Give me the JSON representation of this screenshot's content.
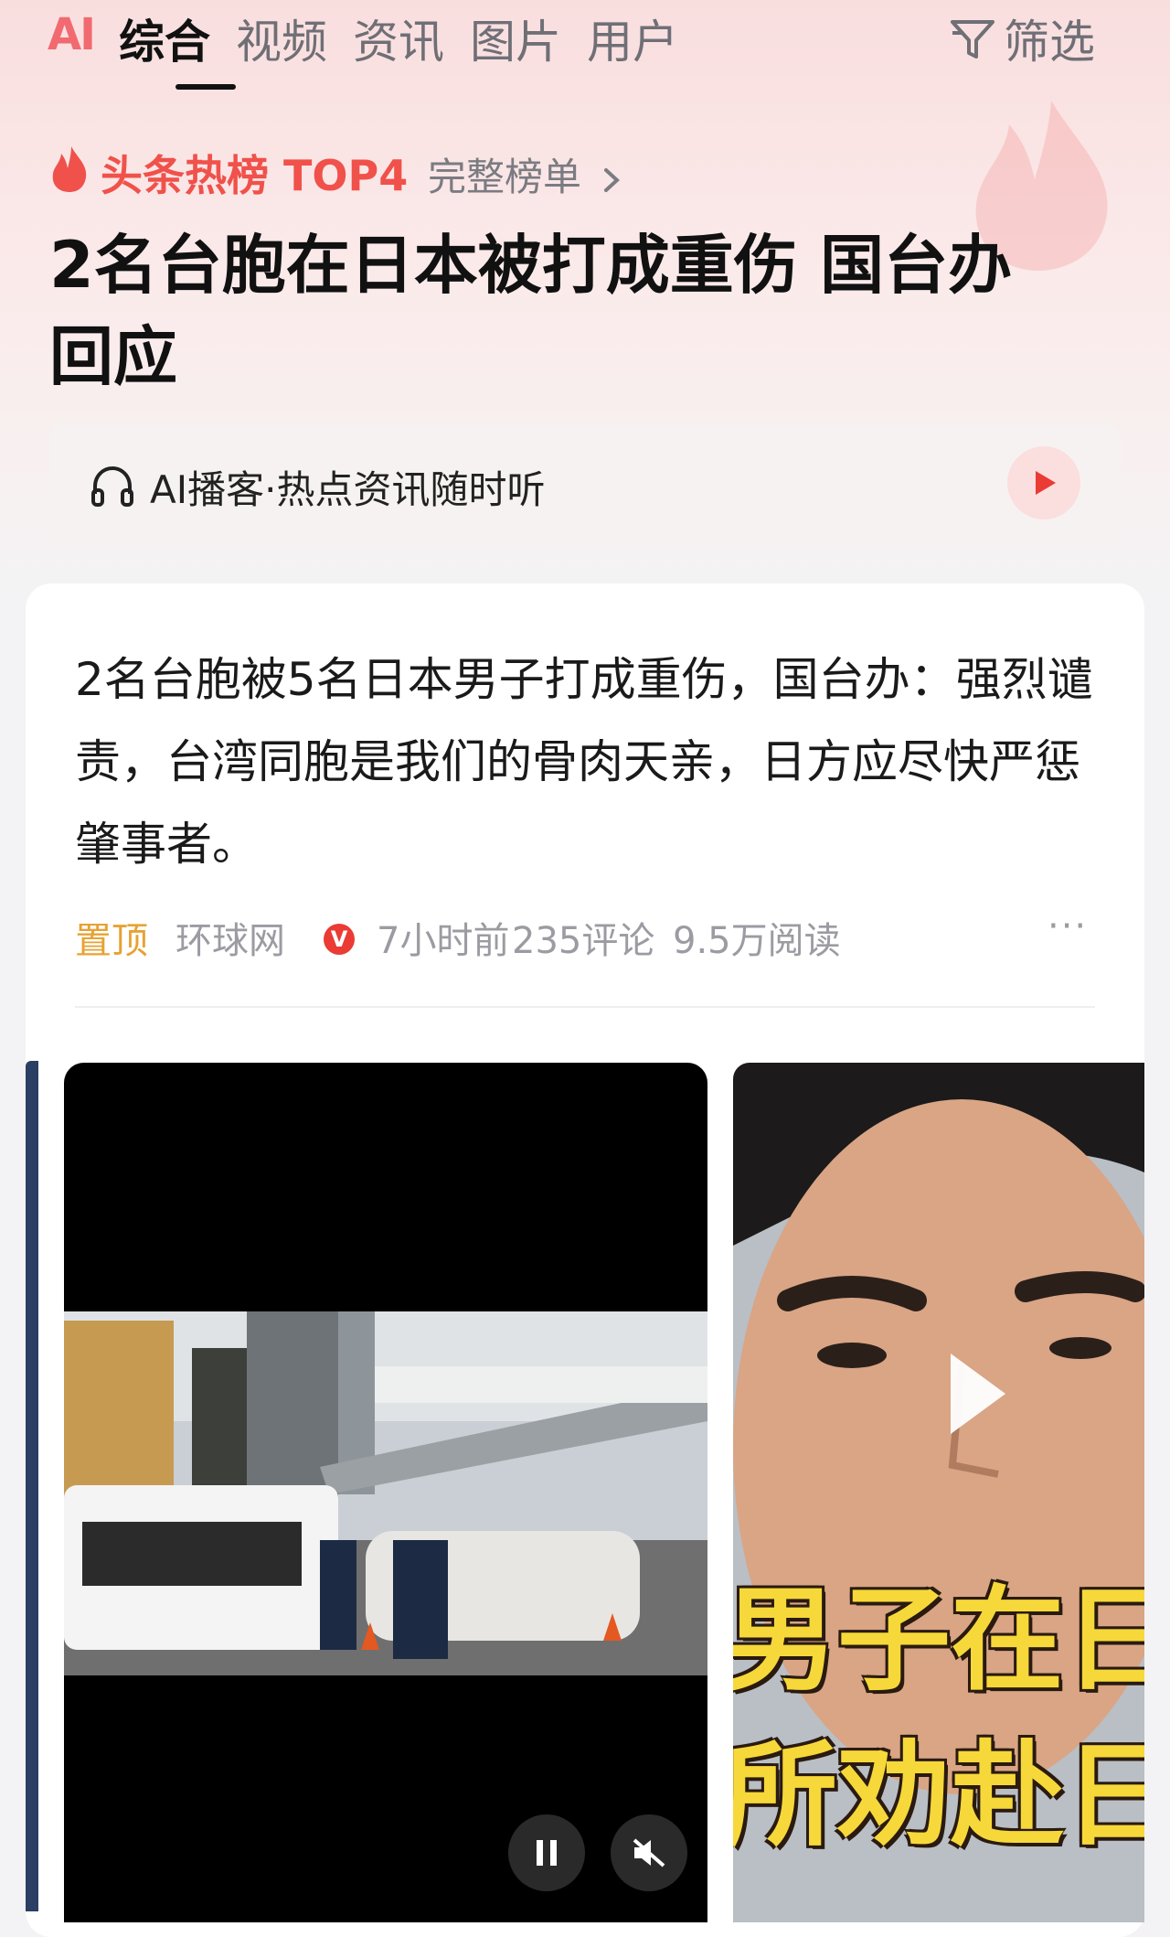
{
  "tabs": {
    "ai": "AI",
    "items": [
      "综合",
      "视频",
      "资讯",
      "图片",
      "用户"
    ],
    "filter": "筛选"
  },
  "hot": {
    "label": "头条热榜 TOP4",
    "full_list": "完整榜单",
    "headline": "2名台胞在日本被打成重伤 国台办回应"
  },
  "podcast": {
    "text": "AI播客·热点资讯随时听",
    "icon": "headphones-icon",
    "play_icon": "play-icon"
  },
  "article": {
    "title": "2名台胞被5名日本男子打成重伤，国台办：强烈谴责，台湾同胞是我们的骨肉天亲，日方应尽快严惩肇事者。",
    "pinned": "置顶",
    "source": "环球网",
    "verified_badge": "V",
    "time": "7小时前",
    "comments": "235评论",
    "reads": "9.5万阅读",
    "more": "···"
  },
  "media": {
    "video_controls": [
      "pause-icon",
      "mute-icon"
    ],
    "thumbnail_caption_line1": "男子在日",
    "thumbnail_caption_line2": "所劝赴日旅"
  },
  "colors": {
    "accent_red": "#f0514b",
    "pinned_orange": "#e7a233",
    "verified_red": "#ea3b34"
  }
}
